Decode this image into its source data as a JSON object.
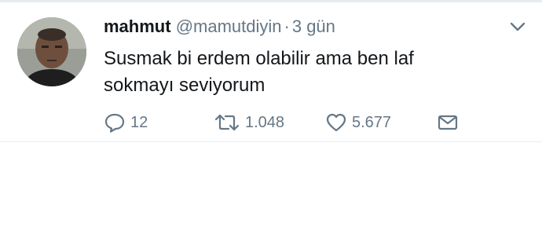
{
  "tweet": {
    "display_name": "mahmut",
    "handle": "@mamutdiyin",
    "separator": "·",
    "time": "3 gün",
    "text_line1": "Susmak bi erdem olabilir ama ben laf",
    "text_line2": "sokmayı seviyorum",
    "reply_count": "12",
    "retweet_count": "1.048",
    "like_count": "5.677"
  },
  "icons": {
    "reply": "reply-icon",
    "retweet": "retweet-icon",
    "like": "heart-icon",
    "dm": "envelope-icon",
    "menu": "chevron-down-icon"
  },
  "colors": {
    "text": "#14171a",
    "secondary": "#657786",
    "border": "#e6ecf0"
  }
}
